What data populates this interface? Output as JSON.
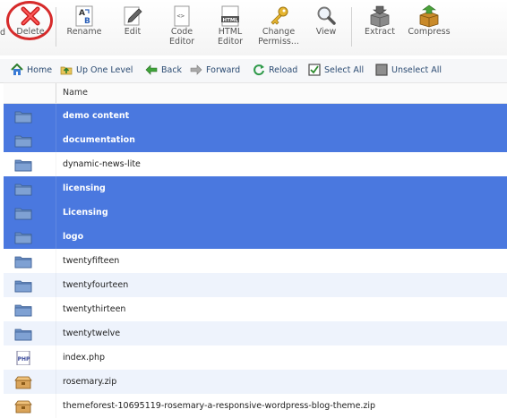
{
  "toolbar": {
    "clipped_label": "d",
    "buttons": [
      {
        "id": "delete",
        "label": "Delete",
        "icon": "delete-x-icon"
      },
      {
        "id": "rename",
        "label": "Rename",
        "icon": "rename-ab-icon"
      },
      {
        "id": "edit",
        "label": "Edit",
        "icon": "edit-pencil-icon"
      },
      {
        "id": "code-editor",
        "label": "Code\nEditor",
        "icon": "code-editor-icon"
      },
      {
        "id": "html-editor",
        "label": "HTML\nEditor",
        "icon": "html-editor-icon"
      },
      {
        "id": "change-permissions",
        "label": "Change\nPermiss...",
        "icon": "key-icon"
      },
      {
        "id": "view",
        "label": "View",
        "icon": "magnifier-icon"
      },
      {
        "id": "extract",
        "label": "Extract",
        "icon": "extract-box-icon"
      },
      {
        "id": "compress",
        "label": "Compress",
        "icon": "compress-box-icon"
      }
    ]
  },
  "navbar": {
    "home": "Home",
    "up_one_level": "Up One Level",
    "back": "Back",
    "forward": "Forward",
    "reload": "Reload",
    "select_all": "Select All",
    "unselect_all": "Unselect All"
  },
  "table": {
    "header_name": "Name",
    "rows": [
      {
        "name": "demo content",
        "type": "folder",
        "selected": true
      },
      {
        "name": "documentation",
        "type": "folder",
        "selected": true
      },
      {
        "name": "dynamic-news-lite",
        "type": "folder",
        "selected": false
      },
      {
        "name": "licensing",
        "type": "folder",
        "selected": true
      },
      {
        "name": "Licensing",
        "type": "folder",
        "selected": true
      },
      {
        "name": "logo",
        "type": "folder",
        "selected": true
      },
      {
        "name": "twentyfifteen",
        "type": "folder",
        "selected": false
      },
      {
        "name": "twentyfourteen",
        "type": "folder",
        "selected": false
      },
      {
        "name": "twentythirteen",
        "type": "folder",
        "selected": false
      },
      {
        "name": "twentytwelve",
        "type": "folder",
        "selected": false
      },
      {
        "name": "index.php",
        "type": "php",
        "selected": false
      },
      {
        "name": "rosemary.zip",
        "type": "zip",
        "selected": false
      },
      {
        "name": "themeforest-10695119-rosemary-a-responsive-wordpress-blog-theme.zip",
        "type": "zip",
        "selected": false
      }
    ]
  },
  "colors": {
    "selected_row": "#4a78df",
    "alt_row": "#eef3fc",
    "delete_ring": "#d62b2b",
    "nav_text": "#2b4b72"
  }
}
